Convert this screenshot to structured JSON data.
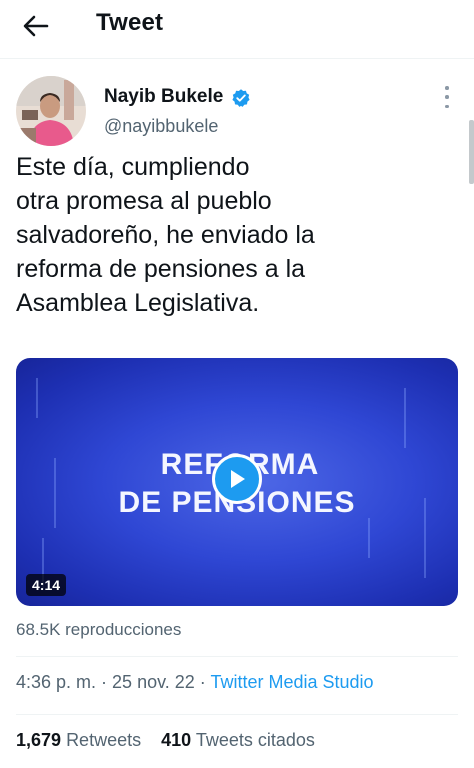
{
  "header": {
    "title": "Tweet"
  },
  "author": {
    "name": "Nayib Bukele",
    "handle": "@nayibbukele"
  },
  "tweet": {
    "text": "Este día, cumpliendo\notra promesa al pueblo\nsalvadoreño, he enviado la\nreforma de pensiones a la\nAsamblea Legislativa."
  },
  "media": {
    "title_line1": "REFORMA",
    "title_line2": "DE PENSIONES",
    "duration": "4:14",
    "views": "68.5K reproducciones"
  },
  "meta": {
    "time": "4:36 p. m.",
    "sep": " · ",
    "date": "25 nov. 22",
    "source": "Twitter Media Studio"
  },
  "stats": {
    "retweets_count": "1,679",
    "retweets_label": "Retweets",
    "quotes_count": "410",
    "quotes_label": "Tweets citados"
  },
  "colors": {
    "accent": "#1d9bf0",
    "text": "#0f1419",
    "secondary": "#536471"
  }
}
